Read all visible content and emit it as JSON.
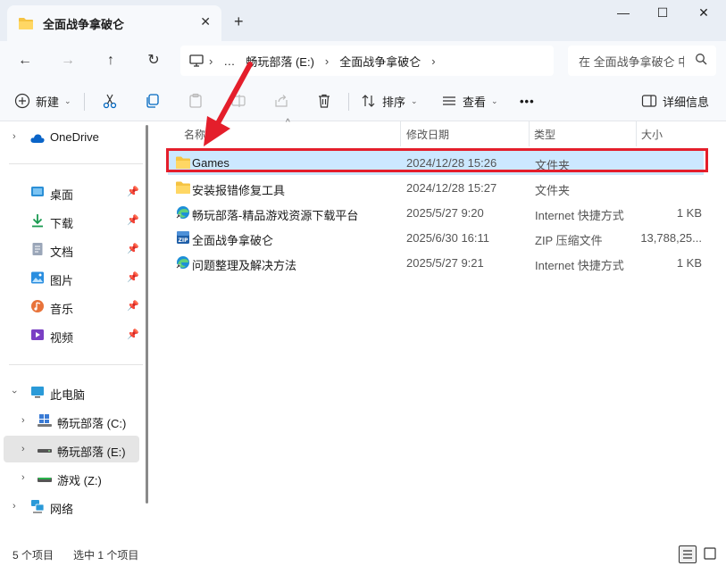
{
  "window": {
    "tab_title": "全面战争拿破仑",
    "tab_close": "✕",
    "new_tab": "+",
    "minimize": "—",
    "maximize": "☐",
    "close": "✕"
  },
  "nav": {
    "back": "←",
    "forward": "→",
    "up": "↑",
    "refresh": "↻",
    "crumbs": [
      "…",
      "畅玩部落 (E:)",
      "全面战争拿破仑"
    ],
    "search_placeholder": "在 全面战争拿破仑 中搜索"
  },
  "toolbar": {
    "new_label": "新建",
    "sort_label": "排序",
    "view_label": "查看",
    "more": "•••",
    "details_label": "详细信息"
  },
  "sidebar": {
    "onedrive": "OneDrive",
    "quick": [
      {
        "label": "桌面"
      },
      {
        "label": "下载"
      },
      {
        "label": "文档"
      },
      {
        "label": "图片"
      },
      {
        "label": "音乐"
      },
      {
        "label": "视频"
      }
    ],
    "this_pc": "此电脑",
    "drives": [
      {
        "label": "畅玩部落 (C:)"
      },
      {
        "label": "畅玩部落 (E:)"
      },
      {
        "label": "游戏 (Z:)"
      }
    ],
    "network": "网络"
  },
  "columns": {
    "name": "名称",
    "modified": "修改日期",
    "type": "类型",
    "size": "大小"
  },
  "files": [
    {
      "name": "Games",
      "modified": "2024/12/28 15:26",
      "type": "文件夹",
      "size": "",
      "icon": "folder-icon"
    },
    {
      "name": "安装报错修复工具",
      "modified": "2024/12/28 15:27",
      "type": "文件夹",
      "size": "",
      "icon": "folder-icon"
    },
    {
      "name": "畅玩部落-精品游戏资源下载平台",
      "modified": "2025/5/27 9:20",
      "type": "Internet 快捷方式",
      "size": "1 KB",
      "icon": "edge-icon"
    },
    {
      "name": "全面战争拿破仑",
      "modified": "2025/6/30 16:11",
      "type": "ZIP 压缩文件",
      "size": "13,788,25...",
      "icon": "zip-icon"
    },
    {
      "name": "问题整理及解决方法",
      "modified": "2025/5/27 9:21",
      "type": "Internet 快捷方式",
      "size": "1 KB",
      "icon": "edge-icon"
    }
  ],
  "status": {
    "count": "5 个项目",
    "selected": "选中 1 个项目"
  },
  "colors": {
    "accent": "#0067c0",
    "folder": "#f5c342",
    "selection": "#cce8ff",
    "annotation_red": "#e41e2b"
  }
}
